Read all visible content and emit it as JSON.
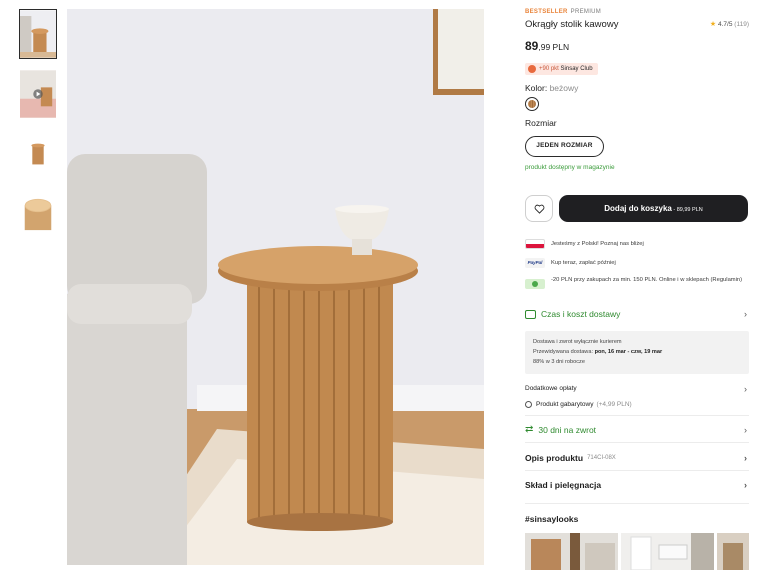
{
  "gallery": {
    "thumbnails": [
      {
        "icon": "table-lifestyle-thumb"
      },
      {
        "icon": "video-thumb"
      },
      {
        "icon": "table-front-thumb"
      },
      {
        "icon": "table-top-thumb"
      }
    ]
  },
  "product": {
    "badge_bestseller": "BESTSELLER",
    "badge_premium": "PREMIUM",
    "title": "Okrągły stolik kawowy",
    "rating": "4.7/5",
    "rating_count": "(119)",
    "price_int": "89",
    "price_dec": ",99",
    "currency": " PLN",
    "club_points": "+90 pkt",
    "club_name": " Sinsay Club",
    "color_label": "Kolor: ",
    "color_value": "beżowy",
    "size_label": "Rozmiar",
    "size_option": "JEDEN ROZMIAR",
    "stock": "produkt dostępny w magazynie",
    "cart_label": "Dodaj do koszyka",
    "cart_price": " - 89,99 PLN"
  },
  "perks": [
    {
      "text": "Jesteśmy z Polski! Poznaj nas bliżej",
      "icon": "poland-flag-icon"
    },
    {
      "text": "Kup teraz, zapłać później",
      "icon": "paypal-icon"
    },
    {
      "text": "-20 PLN przy zakupach za min. 150 PLN. Online i w sklepach (Regulamin)",
      "icon": "gift-icon"
    }
  ],
  "paypal_label": "PayPal",
  "delivery": {
    "title": "Czas i koszt dostawy",
    "line1": "Dostawa i zwrot wyłącznie kurierem",
    "line2_prefix": "Przewidywana dostawa: ",
    "line2_dates": "pon, 16 mar - czw, 19 mar",
    "line3": "88% w 3 dni robocze"
  },
  "extra_fees": "Dodatkowe opłaty",
  "oversize": {
    "label": "Produkt gabarytowy",
    "fee": "(+4,99 PLN)"
  },
  "returns": "30 dni na zwrot",
  "description": {
    "label": "Opis produktu",
    "code": "714CI-08X"
  },
  "composition": "Skład i pielęgnacja",
  "hashtag": "#sinsaylooks",
  "colors": {
    "cart_bg": "#1f1f22",
    "green": "#2f8a2f",
    "accent": "#e9843a",
    "wood": "#c08a55"
  }
}
